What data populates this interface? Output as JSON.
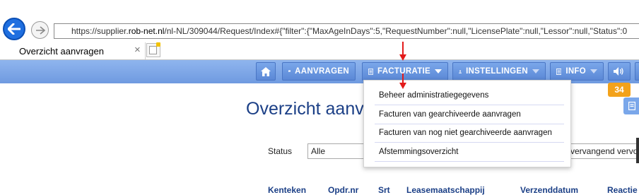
{
  "browser": {
    "url_prefix": "https://supplier.",
    "url_host": "rob-net.nl",
    "url_rest": "/nl-NL/309044/Request/Index#{\"filter\":{\"MaxAgeInDays\":5,\"RequestNumber\":null,\"LicensePlate\":null,\"Lessor\":null,\"Status\":0",
    "tab_title": "Overzicht aanvragen",
    "tab_close": "×"
  },
  "nav": {
    "requests_label": "AANVRAGEN",
    "invoicing_label": "FACTURATIE",
    "settings_label": "INSTELLINGEN",
    "info_label": "INFO",
    "notification_count": "34"
  },
  "dropdown": {
    "items": [
      "Beheer administratiegegevens",
      "Facturen van gearchiveerde aanvragen",
      "Facturen van nog niet gearchiveerde aanvragen",
      "Afstemmingsoverzicht"
    ]
  },
  "page": {
    "title": "Overzicht aanvragen",
    "status_label": "Status",
    "status_value": "Alle",
    "replacement_value": "vervangend vervoer"
  },
  "table": {
    "columns": [
      "Kenteken",
      "Opdr.nr",
      "Srt",
      "Leasemaatschappij",
      "Verzenddatum",
      "Reactie"
    ]
  },
  "colors": {
    "nav_blue": "#6f9ae0",
    "title_blue": "#1b3f86",
    "badge_orange": "#f3a21a",
    "arrow_red": "#e31b1b"
  }
}
